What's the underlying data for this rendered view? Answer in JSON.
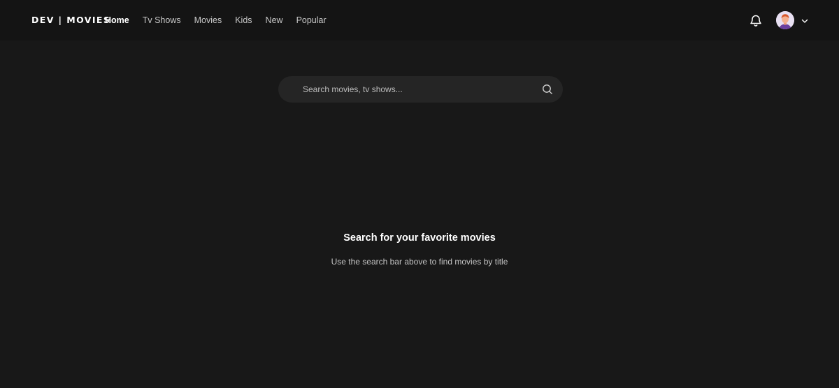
{
  "header": {
    "logo": "DEV | MOVIES",
    "nav": [
      {
        "label": "Home",
        "active": true
      },
      {
        "label": "Tv Shows",
        "active": false
      },
      {
        "label": "Movies",
        "active": false
      },
      {
        "label": "Kids",
        "active": false
      },
      {
        "label": "New",
        "active": false
      },
      {
        "label": "Popular",
        "active": false
      }
    ],
    "icons": {
      "notifications": "bell-icon",
      "profile": "avatar",
      "menu": "chevron-down-icon"
    }
  },
  "search": {
    "placeholder": "Search movies, tv shows...",
    "value": "",
    "icon": "search-icon"
  },
  "empty_state": {
    "title": "Search for your favorite movies",
    "subtitle": "Use the search bar above to find movies by title"
  },
  "colors": {
    "background": "#181818",
    "header_background": "#141414",
    "search_background": "#252525",
    "text_primary": "#ffffff",
    "text_secondary": "#c4c4c4"
  }
}
